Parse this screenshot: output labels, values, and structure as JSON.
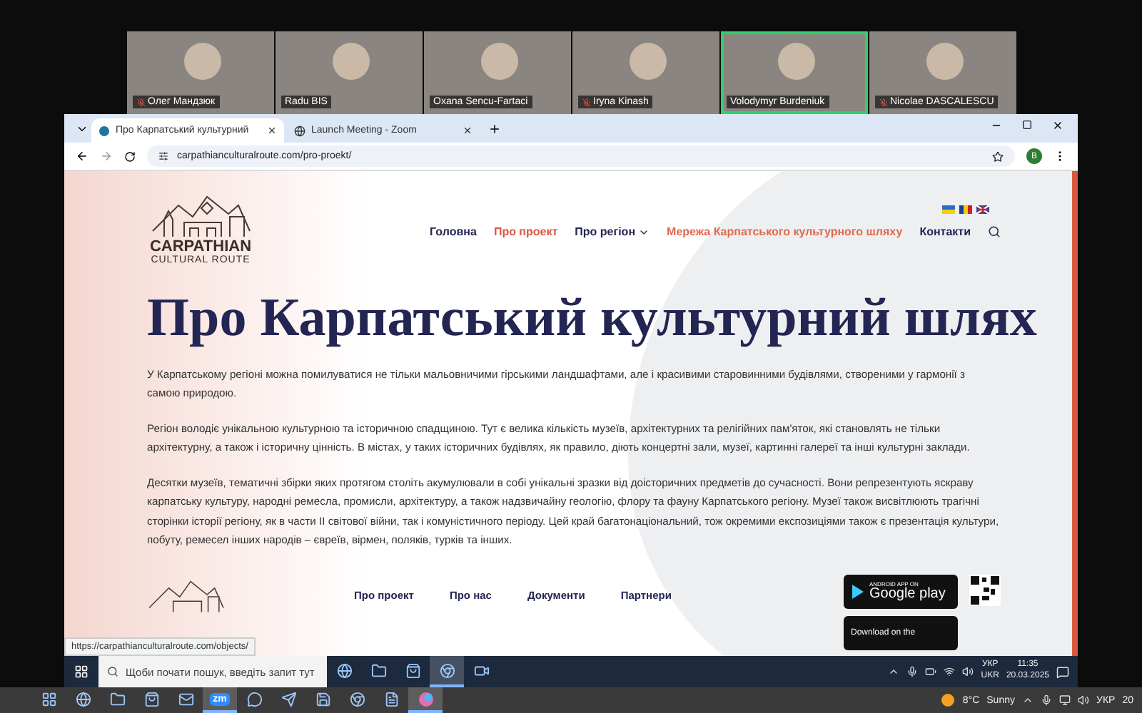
{
  "meeting": {
    "participants": [
      {
        "name": "Олег Мандзюк",
        "muted": true,
        "speaking": false
      },
      {
        "name": "Radu BIS",
        "muted": false,
        "speaking": false
      },
      {
        "name": "Oxana Sencu-Fartaci",
        "muted": false,
        "speaking": false
      },
      {
        "name": "Iryna Kinash",
        "muted": true,
        "speaking": false
      },
      {
        "name": "Volodymyr Burdeniuk",
        "muted": false,
        "speaking": true
      },
      {
        "name": "Nicolae DASCALESCU",
        "muted": true,
        "speaking": false
      }
    ]
  },
  "browser": {
    "tabs": [
      {
        "title": "Про Карпатський культурний",
        "kind": "site",
        "selected": true
      },
      {
        "title": "Launch Meeting - Zoom",
        "kind": "globe",
        "selected": false
      }
    ],
    "url": "carpathianculturalroute.com/pro-proekt/",
    "profile": "B",
    "status_url": "https://carpathianculturalroute.com/objects/"
  },
  "site": {
    "logo": {
      "title": "CARPATHIAN",
      "subtitle": "CULTURAL ROUTE"
    },
    "languages": [
      {
        "kind": "ua"
      },
      {
        "kind": "ro"
      },
      {
        "kind": "gb"
      }
    ],
    "nav": [
      {
        "label": "Головна",
        "selected": false,
        "hovered": false,
        "dropdown": false
      },
      {
        "label": "Про проект",
        "selected": true,
        "hovered": false,
        "dropdown": false
      },
      {
        "label": "Про регіон",
        "selected": false,
        "hovered": false,
        "dropdown": true
      },
      {
        "label": "Мережа Карпатського культурного шляху",
        "selected": false,
        "hovered": true,
        "dropdown": false
      },
      {
        "label": "Контакти",
        "selected": false,
        "hovered": false,
        "dropdown": false
      }
    ],
    "heading": "Про Карпатський культурний шлях",
    "paragraphs": [
      "У Карпатському регіоні можна помилуватися не тільки мальовничими гірськими ландшафтами, але і красивими старовинними будівлями, створеними у гармонії з самою природою.",
      "Регіон володіє унікальною культурною та історичною спадщиною. Тут є велика кількість музеїв, архітектурних та релігійних пам'яток, які становлять не тільки архітектурну, а також і історичну цінність. В містах, у таких історичних будівлях, як правило, діють концертні зали, музеї, картинні галереї та інші культурні заклади.",
      "Десятки музеїв, тематичні збірки яких протягом століть акумулювали в собі унікальні зразки від доісторичних предметів до сучасності. Вони репрезентують яскраву карпатську культуру, народні ремесла, промисли, архітектуру, а також надзвичайну геологію, флору та фауну Карпатського регіону. Музеї також висвітлюють трагічні сторінки історії регіону, як в части II світової війни, так і комуністичного періоду. Цей край багатонаціональний, тож окремими експозиціями також є презентація культури, побуту, ремесел інших народів – євреїв, вірмен, поляків, турків та інших."
    ],
    "footer_links": [
      "Про проект",
      "Про нас",
      "Документи",
      "Партнери"
    ],
    "google_play": {
      "caption": "ANDROID APP ON",
      "label": "Google play"
    },
    "app_store": {
      "label": "Download on the"
    }
  },
  "inner_taskbar": {
    "search": {
      "placeholder": "Щоби почати пошук, введіть запит тут"
    },
    "apps": [
      {
        "kind": "browser",
        "selected": false
      },
      {
        "kind": "folder",
        "selected": false
      },
      {
        "kind": "store",
        "selected": false
      },
      {
        "kind": "chrome",
        "selected": true
      },
      {
        "kind": "video",
        "selected": false
      }
    ],
    "language": [
      "УКР",
      "UKR"
    ],
    "time": "11:35",
    "date": "20.03.2025"
  },
  "outer_taskbar": {
    "apps": [
      {
        "kind": "widgets",
        "selected": false
      },
      {
        "kind": "browser",
        "selected": false
      },
      {
        "kind": "folder",
        "selected": false
      },
      {
        "kind": "store",
        "selected": false
      },
      {
        "kind": "mail",
        "selected": false
      },
      {
        "kind": "zoom",
        "label": "zm",
        "selected": true
      },
      {
        "kind": "chat",
        "selected": false
      },
      {
        "kind": "send",
        "selected": false
      },
      {
        "kind": "save",
        "selected": false
      },
      {
        "kind": "chrome",
        "selected": false
      },
      {
        "kind": "document",
        "selected": false
      },
      {
        "kind": "color",
        "selected": true
      }
    ],
    "temperature": "8°C",
    "weather": "Sunny",
    "language": "УКР",
    "date": "20"
  }
}
